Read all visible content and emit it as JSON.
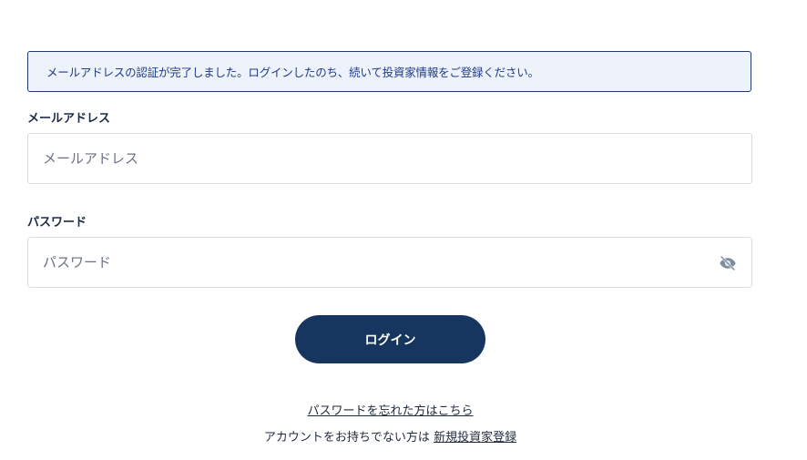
{
  "alert": {
    "message": "メールアドレスの認証が完了しました。ログインしたのち、続いて投資家情報をご登録ください。"
  },
  "email": {
    "label": "メールアドレス",
    "placeholder": "メールアドレス",
    "value": ""
  },
  "password": {
    "label": "パスワード",
    "placeholder": "パスワード",
    "value": "",
    "toggle_icon": "eye-off-icon"
  },
  "login_button": {
    "label": "ログイン"
  },
  "links": {
    "forgot_password": "パスワードを忘れた方はこちら",
    "no_account_prefix": "アカウントをお持ちでない方は",
    "register": "新規投資家登録"
  },
  "colors": {
    "primary": "#17365f",
    "alert_bg": "#eef2fb",
    "alert_border": "#1e3a6e"
  }
}
